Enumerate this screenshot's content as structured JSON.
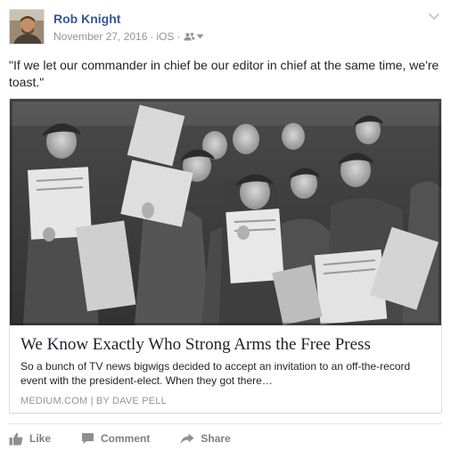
{
  "post": {
    "author": "Rob Knight",
    "date": "November 27, 2016",
    "separator": "·",
    "platform": "iOS",
    "audience_icon": "friends-icon",
    "message": "\"If we let our commander in chief be our editor in chief at the same time, we're toast.\""
  },
  "link_card": {
    "image_description_icon": "newsboys-photo",
    "title": "We Know Exactly Who Strong Arms the Free Press",
    "description": "So a bunch of TV news bigwigs decided to accept an invitation to an off-the-record event with the president-elect. When they got there…",
    "source": "MEDIUM.COM | BY DAVE PELL"
  },
  "actions": {
    "like_label": "Like",
    "comment_label": "Comment",
    "share_label": "Share"
  },
  "colors": {
    "author_link": "#365899",
    "meta_text": "#90949c",
    "action_text": "#7f7f7f",
    "border": "#dddfe2"
  }
}
